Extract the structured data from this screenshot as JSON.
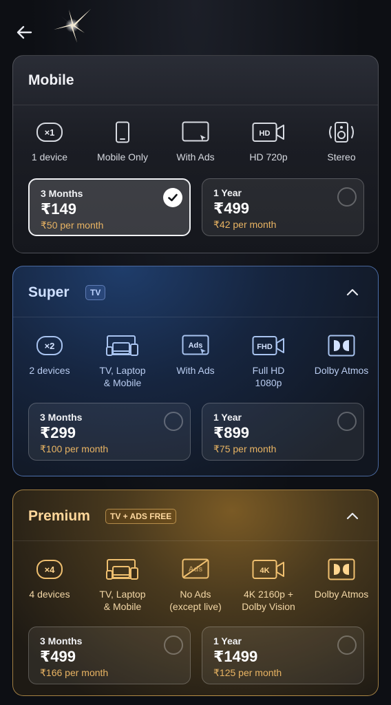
{
  "plans": {
    "mobile": {
      "title": "Mobile",
      "features": [
        {
          "icon": "device-count-icon",
          "badge": "×1",
          "label": "1 device"
        },
        {
          "icon": "phone-icon",
          "label": "Mobile Only"
        },
        {
          "icon": "ads-icon",
          "badge": "Ads",
          "label": "With Ads"
        },
        {
          "icon": "video-camera-icon",
          "badge": "HD",
          "label": "HD 720p"
        },
        {
          "icon": "speaker-icon",
          "label": "Stereo"
        }
      ],
      "options": [
        {
          "period": "3 Months",
          "price": "₹149",
          "per_month": "₹50 per month",
          "selected": true
        },
        {
          "period": "1 Year",
          "price": "₹499",
          "per_month": "₹42 per month",
          "selected": false
        }
      ]
    },
    "super": {
      "title": "Super",
      "tag": "TV",
      "features": [
        {
          "icon": "device-count-icon",
          "badge": "×2",
          "label": "2 devices"
        },
        {
          "icon": "tv-laptop-mobile-icon",
          "label": "TV, Laptop\n& Mobile"
        },
        {
          "icon": "ads-icon",
          "badge": "Ads",
          "label": "With Ads"
        },
        {
          "icon": "video-camera-icon",
          "badge": "FHD",
          "label": "Full HD\n1080p"
        },
        {
          "icon": "dolby-icon",
          "label": "Dolby Atmos"
        }
      ],
      "options": [
        {
          "period": "3 Months",
          "price": "₹299",
          "per_month": "₹100 per month",
          "selected": false
        },
        {
          "period": "1 Year",
          "price": "₹899",
          "per_month": "₹75 per month",
          "selected": false
        }
      ]
    },
    "premium": {
      "title": "Premium",
      "tag": "TV + ADS FREE",
      "features": [
        {
          "icon": "device-count-icon",
          "badge": "×4",
          "label": "4 devices"
        },
        {
          "icon": "tv-laptop-mobile-icon",
          "label": "TV, Laptop\n& Mobile"
        },
        {
          "icon": "no-ads-icon",
          "badge": "Ads",
          "label": "No Ads\n(except live)"
        },
        {
          "icon": "video-camera-icon",
          "badge": "4K",
          "label": "4K 2160p +\nDolby Vision"
        },
        {
          "icon": "dolby-icon",
          "label": "Dolby Atmos"
        }
      ],
      "options": [
        {
          "period": "3 Months",
          "price": "₹499",
          "per_month": "₹166 per month",
          "selected": false
        },
        {
          "period": "1 Year",
          "price": "₹1499",
          "per_month": "₹125 per month",
          "selected": false
        }
      ]
    }
  },
  "colors": {
    "background": "#0d0f14",
    "per_month_accent": "#e9b463",
    "super_accent": "#a9c4f0",
    "premium_accent": "#f0c070"
  }
}
